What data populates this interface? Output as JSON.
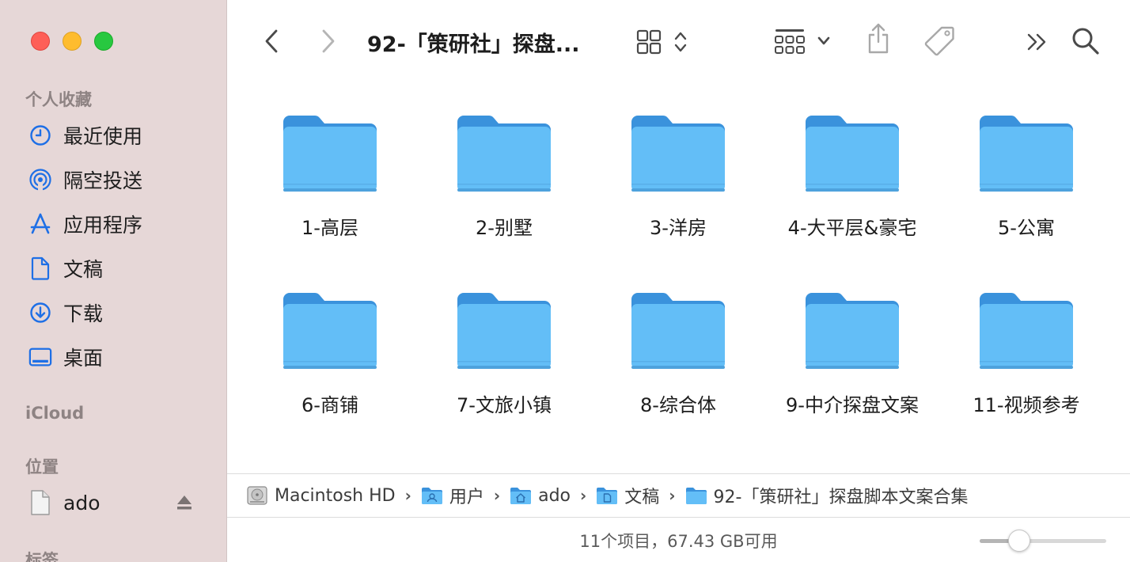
{
  "window": {
    "title": "92-「策研社」探盘...",
    "colors": {
      "accent": "#1e6fe6",
      "folder": "#63bef7",
      "folder_tab": "#3a92dc"
    }
  },
  "sidebar": {
    "favorites_title": "个人收藏",
    "favorites": [
      {
        "label": "最近使用",
        "icon": "clock-icon"
      },
      {
        "label": "隔空投送",
        "icon": "airdrop-icon"
      },
      {
        "label": "应用程序",
        "icon": "applications-icon"
      },
      {
        "label": "文稿",
        "icon": "document-icon"
      },
      {
        "label": "下载",
        "icon": "download-icon"
      },
      {
        "label": "桌面",
        "icon": "desktop-icon"
      }
    ],
    "icloud_title": "iCloud",
    "locations_title": "位置",
    "locations": [
      {
        "label": "ado",
        "icon": "file-icon"
      }
    ],
    "tags_title": "标签"
  },
  "folders": [
    {
      "name": "1-高层"
    },
    {
      "name": "2-别墅"
    },
    {
      "name": "3-洋房"
    },
    {
      "name": "4-大平层&豪宅"
    },
    {
      "name": "5-公寓"
    },
    {
      "name": "6-商铺"
    },
    {
      "name": "7-文旅小镇"
    },
    {
      "name": "8-综合体"
    },
    {
      "name": "9-中介探盘文案"
    },
    {
      "name": "11-视频参考"
    }
  ],
  "pathbar": {
    "crumbs": [
      {
        "label": "Macintosh HD",
        "icon": "disk-icon"
      },
      {
        "label": "用户",
        "icon": "users-folder-icon"
      },
      {
        "label": "ado",
        "icon": "home-folder-icon"
      },
      {
        "label": "文稿",
        "icon": "documents-folder-icon"
      },
      {
        "label": "92-「策研社」探盘脚本文案合集",
        "icon": "folder-icon"
      }
    ],
    "separator": "›"
  },
  "status": {
    "text": "11个项目，67.43 GB可用",
    "icon_size_fraction": 0.27
  }
}
